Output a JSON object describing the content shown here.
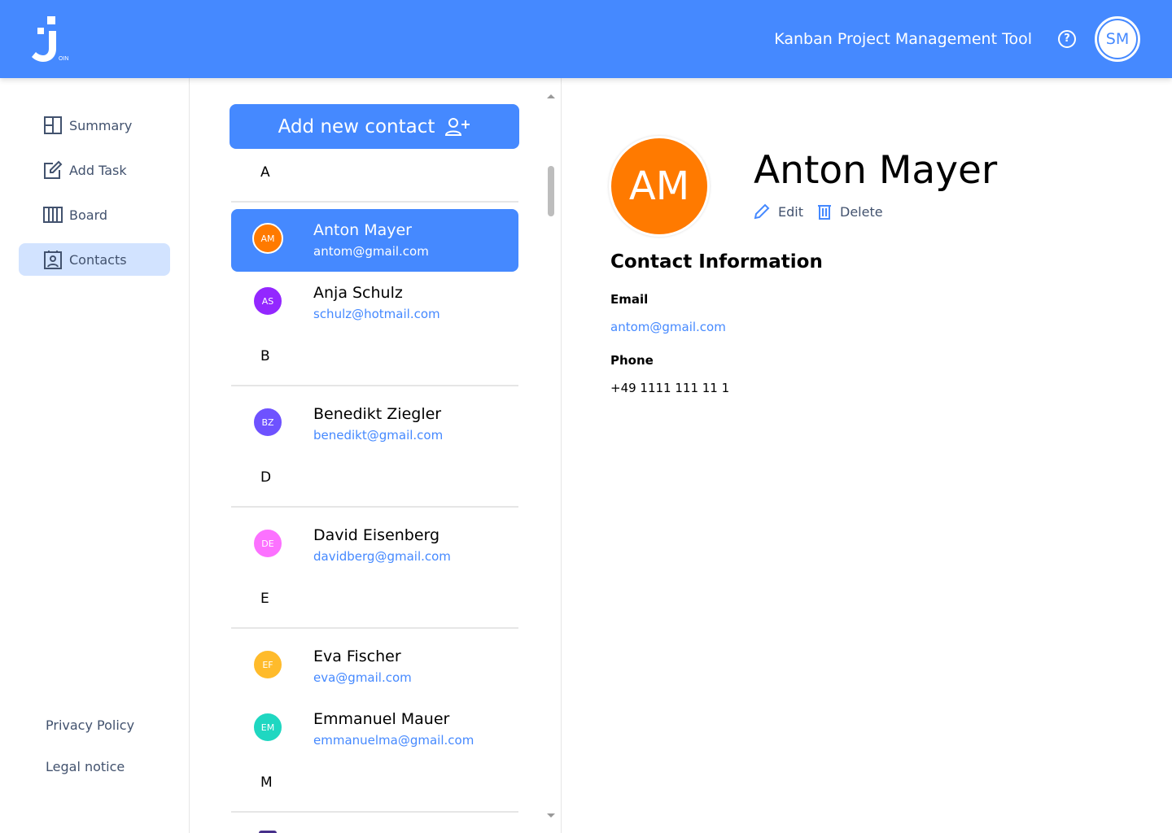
{
  "header": {
    "logo_text": "OIN",
    "title": "Kanban Project Management Tool",
    "help": "?",
    "user_initials": "SM"
  },
  "sidebar": {
    "items": [
      {
        "label": "Summary"
      },
      {
        "label": "Add Task"
      },
      {
        "label": "Board"
      },
      {
        "label": "Contacts"
      }
    ],
    "privacy": "Privacy Policy",
    "legal": "Legal notice"
  },
  "list": {
    "add_label": "Add new contact",
    "groups": [
      {
        "letter": "A",
        "contacts": [
          {
            "initials": "AM",
            "name": "Anton Mayer",
            "email": "antom@gmail.com",
            "color": "#ff7a00"
          },
          {
            "initials": "AS",
            "name": "Anja Schulz",
            "email": "schulz@hotmail.com",
            "color": "#9327ff"
          }
        ]
      },
      {
        "letter": "B",
        "contacts": [
          {
            "initials": "BZ",
            "name": "Benedikt Ziegler",
            "email": "benedikt@gmail.com",
            "color": "#6e52ff"
          }
        ]
      },
      {
        "letter": "D",
        "contacts": [
          {
            "initials": "DE",
            "name": "David Eisenberg",
            "email": "davidberg@gmail.com",
            "color": "#fc71ff"
          }
        ]
      },
      {
        "letter": "E",
        "contacts": [
          {
            "initials": "EF",
            "name": "Eva Fischer",
            "email": "eva@gmail.com",
            "color": "#ffbb2b"
          },
          {
            "initials": "EM",
            "name": "Emmanuel Mauer",
            "email": "emmanuelma@gmail.com",
            "color": "#1fd7c1"
          }
        ]
      },
      {
        "letter": "M",
        "contacts": [
          {
            "initials": "",
            "name": "",
            "email": "",
            "color": "#462f8a"
          }
        ]
      }
    ]
  },
  "detail": {
    "initials": "AM",
    "name": "Anton Mayer",
    "edit": "Edit",
    "delete": "Delete",
    "section": "Contact Information",
    "email_label": "Email",
    "email": "antom@gmail.com",
    "phone_label": "Phone",
    "phone": "+49 1111 111 11 1"
  }
}
